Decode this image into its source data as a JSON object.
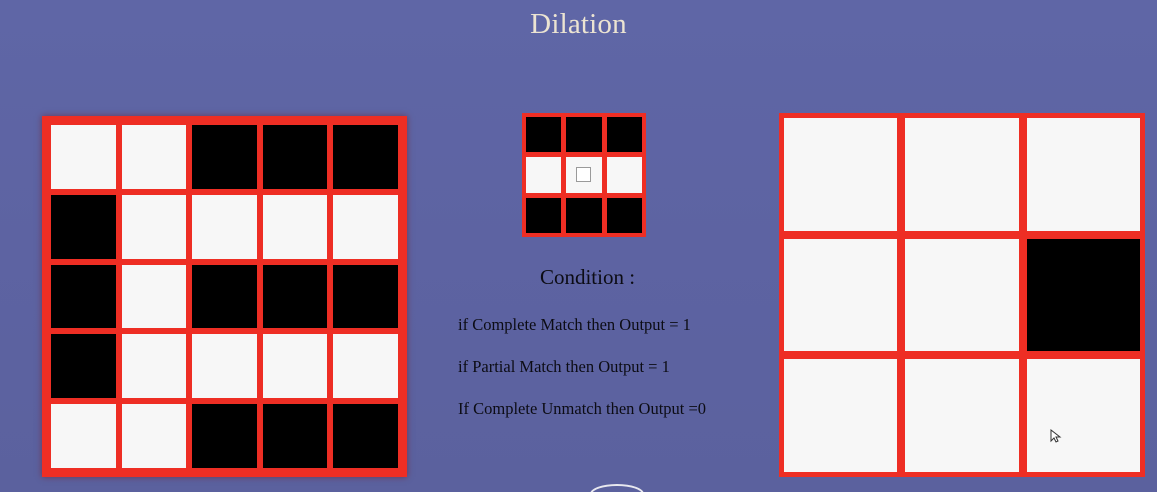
{
  "slide": {
    "title": "Dilation",
    "condition_title": "Condition :",
    "rules": [
      "if Complete Match then Output = 1",
      "if Partial Match then Output = 1",
      "If Complete Unmatch then Output =0"
    ]
  },
  "input_image": [
    [
      0,
      0,
      1,
      1,
      1
    ],
    [
      1,
      0,
      0,
      0,
      0
    ],
    [
      1,
      0,
      1,
      1,
      1
    ],
    [
      1,
      0,
      0,
      0,
      0
    ],
    [
      0,
      0,
      1,
      1,
      1
    ]
  ],
  "structuring_element": [
    [
      1,
      1,
      1
    ],
    [
      0,
      0,
      0
    ],
    [
      1,
      1,
      1
    ]
  ],
  "output_image": [
    [
      0,
      0,
      0
    ],
    [
      0,
      0,
      1
    ],
    [
      0,
      0,
      0
    ]
  ],
  "colors": {
    "background": "#5f66a6",
    "border": "#ee2e24",
    "filled": "#000000",
    "empty": "#f7f7f7",
    "title_text": "#ece4d2"
  }
}
